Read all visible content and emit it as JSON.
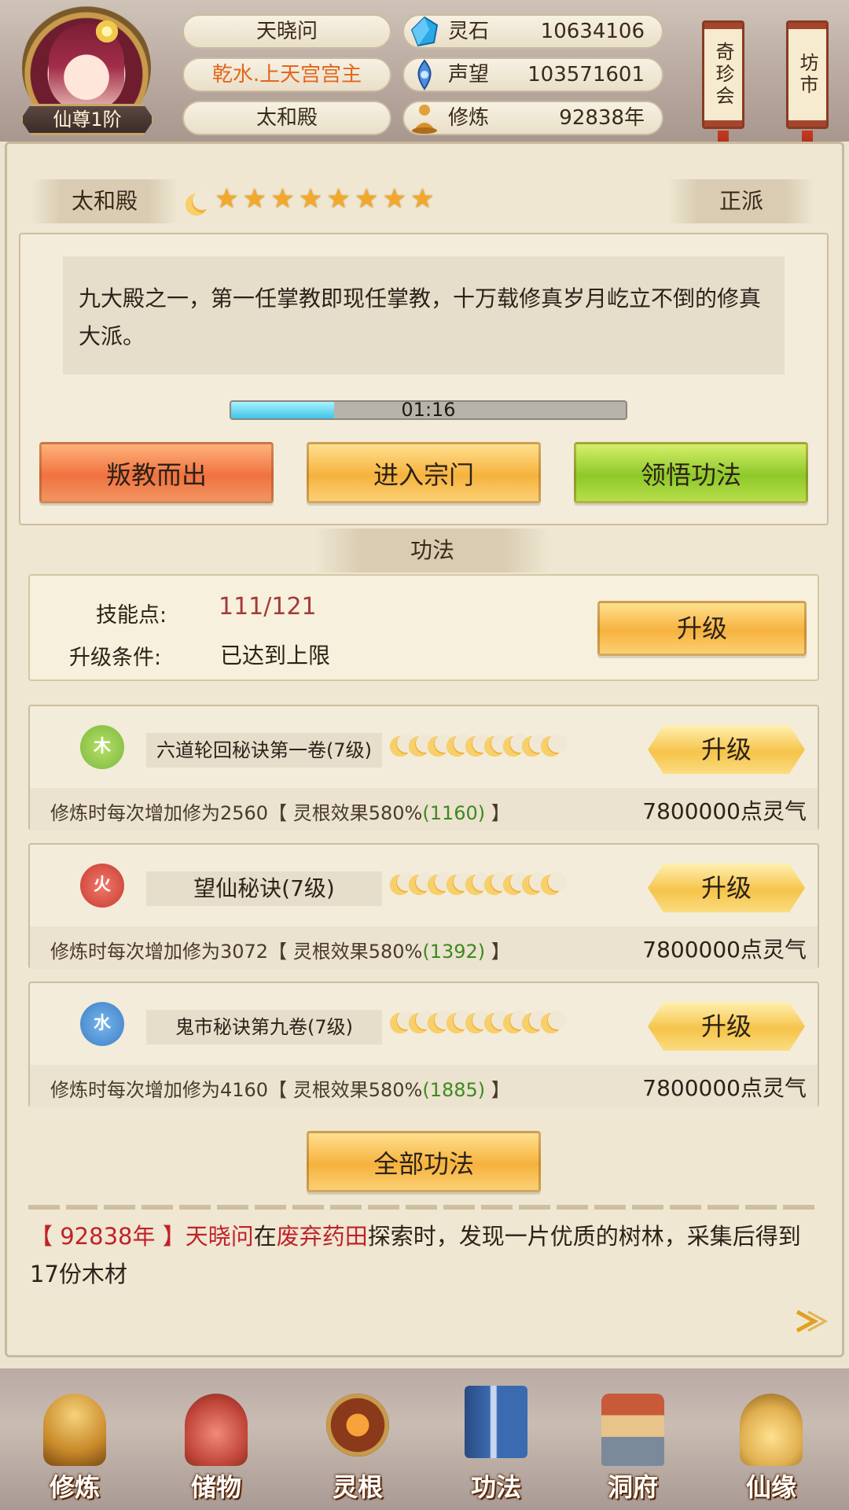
{
  "header": {
    "player_name": "天晓问",
    "title": "乾水.上天宫宫主",
    "sect": "太和殿",
    "rank": "仙尊1阶",
    "resources": [
      {
        "icon": "spirit-stone-icon",
        "label": "灵石",
        "value": "10634106"
      },
      {
        "icon": "reputation-icon",
        "label": "声望",
        "value": "103571601"
      },
      {
        "icon": "cultivation-icon",
        "label": "修炼",
        "value": "92838年"
      }
    ],
    "side_banners": [
      {
        "label": "奇珍会"
      },
      {
        "label": "坊市"
      }
    ]
  },
  "sect_panel": {
    "name": "太和殿",
    "alignment": "正派",
    "star_rating": 9,
    "description": "九大殿之一，第一任掌教即现任掌教，十万载修真岁月屹立不倒的修真大派。",
    "timer": "01:16",
    "timer_progress": 0.26,
    "buttons": {
      "leave": "叛教而出",
      "enter": "进入宗门",
      "comprehend": "领悟功法"
    }
  },
  "techniques": {
    "section_title": "功法",
    "skill_points_label": "技能点:",
    "skill_points_value": "111/121",
    "upgrade_cond_label": "升级条件:",
    "upgrade_cond_value": "已达到上限",
    "upgrade_label": "升级",
    "items": [
      {
        "element": "木",
        "element_color": "#8cc63a",
        "name": "六道轮回秘诀第一卷(7级)",
        "moons": 9,
        "upgrade_label": "升级",
        "effect_prefix": "修炼时每次增加修为2560【 灵根效果580%",
        "effect_bonus": "(1160)",
        "effect_suffix": " 】",
        "cost": "7800000点灵气"
      },
      {
        "element": "火",
        "element_color": "#d9463a",
        "name": "望仙秘诀(7级)",
        "moons": 9,
        "upgrade_label": "升级",
        "effect_prefix": "修炼时每次增加修为3072【 灵根效果580%",
        "effect_bonus": "(1392)",
        "effect_suffix": " 】",
        "cost": "7800000点灵气"
      },
      {
        "element": "水",
        "element_color": "#3c8ed0",
        "name": "鬼市秘诀第九卷(7级)",
        "moons": 9,
        "upgrade_label": "升级",
        "effect_prefix": "修炼时每次增加修为4160【 灵根效果580%",
        "effect_bonus": "(1885)",
        "effect_suffix": " 】",
        "cost": "7800000点灵气"
      }
    ],
    "all_button": "全部功法"
  },
  "log": {
    "bracket_open": "【",
    "year": " 92838年 ",
    "bracket_close": "】",
    "actor": "天晓问",
    "mid1": "在",
    "place": "废弃药田",
    "rest": "探索时，发现一片优质的树林，采集后得到17份木材"
  },
  "bottom_nav": [
    {
      "label": "修炼",
      "icon": "cultivate-icon",
      "color": "#c98a2a"
    },
    {
      "label": "储物",
      "icon": "storage-bag-icon",
      "color": "#c2473a"
    },
    {
      "label": "灵根",
      "icon": "spirit-root-icon",
      "color": "#8a3a1a"
    },
    {
      "label": "功法",
      "icon": "technique-book-icon",
      "color": "#3a6ab0"
    },
    {
      "label": "洞府",
      "icon": "cave-dwelling-icon",
      "color": "#a86a3a"
    },
    {
      "label": "仙缘",
      "icon": "immortal-fate-icon",
      "color": "#e0b050"
    }
  ]
}
